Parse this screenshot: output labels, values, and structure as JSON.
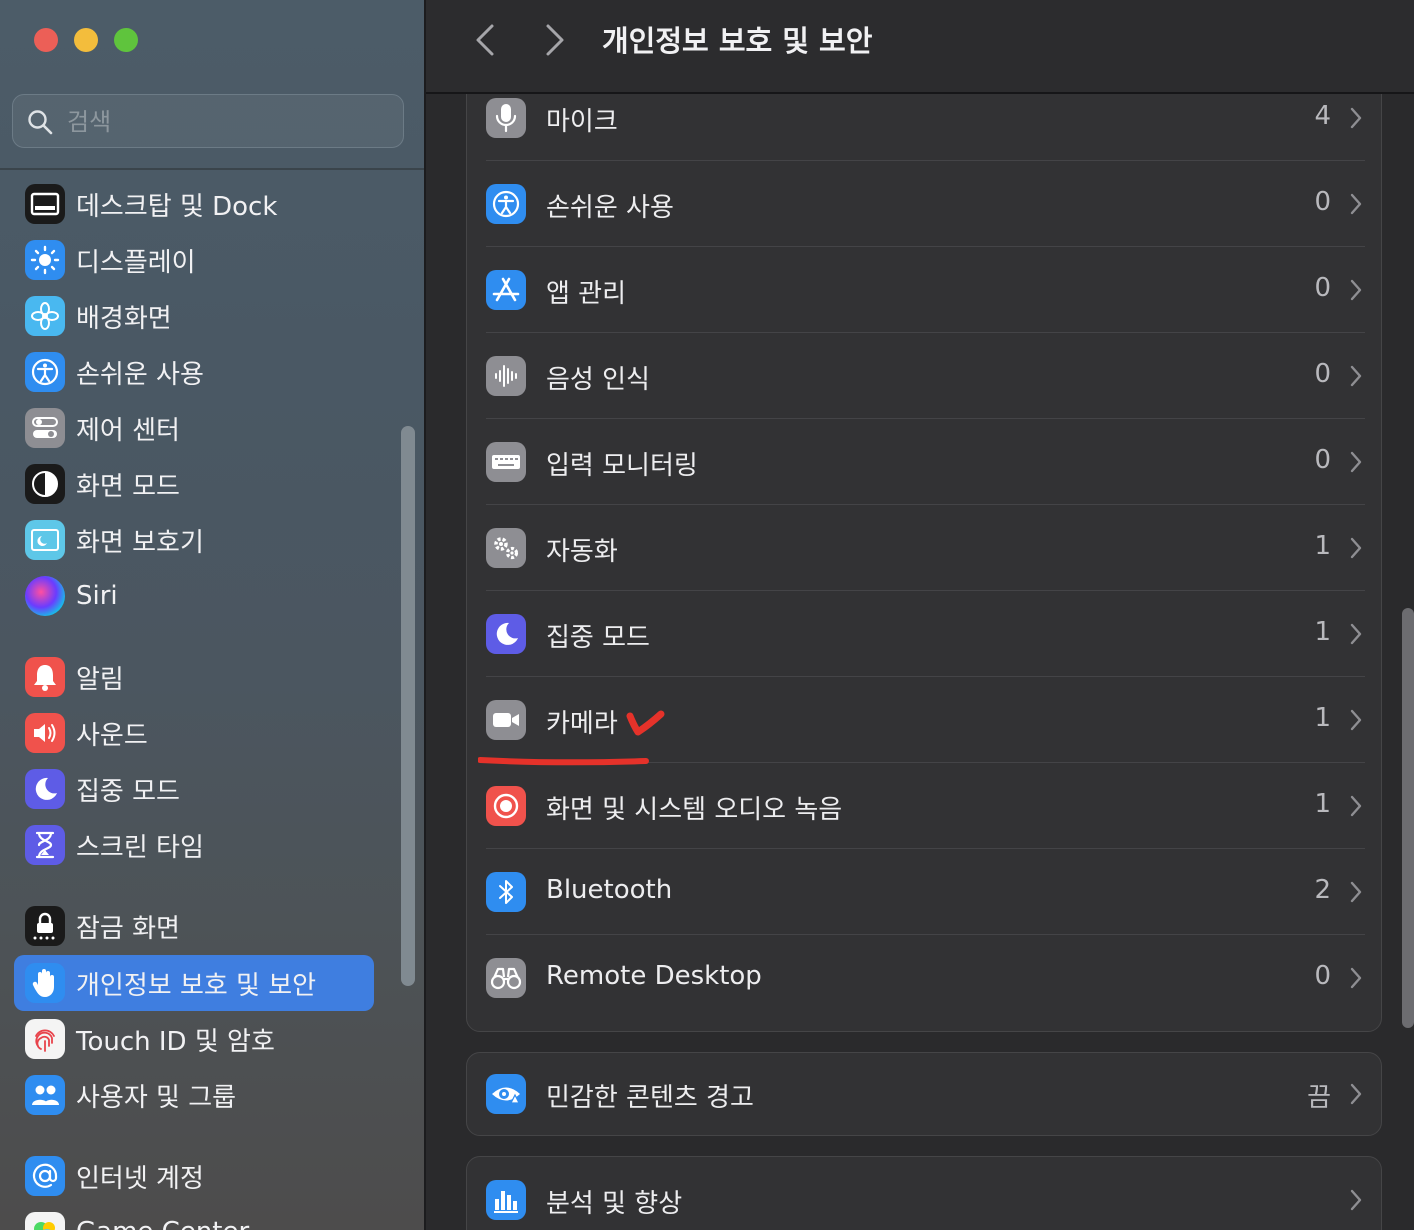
{
  "search": {
    "placeholder": "검색"
  },
  "sidebar": {
    "items": [
      {
        "label": "데스크탑 및 Dock"
      },
      {
        "label": "디스플레이"
      },
      {
        "label": "배경화면"
      },
      {
        "label": "손쉬운 사용"
      },
      {
        "label": "제어 센터"
      },
      {
        "label": "화면 모드"
      },
      {
        "label": "화면 보호기"
      },
      {
        "label": "Siri"
      },
      {
        "label": "알림"
      },
      {
        "label": "사운드"
      },
      {
        "label": "집중 모드"
      },
      {
        "label": "스크린 타임"
      },
      {
        "label": "잠금 화면"
      },
      {
        "label": "개인정보 보호 및 보안"
      },
      {
        "label": "Touch ID 및 암호"
      },
      {
        "label": "사용자 및 그룹"
      },
      {
        "label": "인터넷 계정"
      },
      {
        "label": "Game Center"
      }
    ],
    "active_label": "개인정보 보호 및 보안"
  },
  "header": {
    "title": "개인정보 보호 및 보안"
  },
  "rows": [
    {
      "label": "마이크",
      "value": "4"
    },
    {
      "label": "손쉬운 사용",
      "value": "0"
    },
    {
      "label": "앱 관리",
      "value": "0"
    },
    {
      "label": "음성 인식",
      "value": "0"
    },
    {
      "label": "입력 모니터링",
      "value": "0"
    },
    {
      "label": "자동화",
      "value": "1"
    },
    {
      "label": "집중 모드",
      "value": "1"
    },
    {
      "label": "카메라",
      "value": "1"
    },
    {
      "label": "화면 및 시스템 오디오 녹음",
      "value": "1"
    },
    {
      "label": "Bluetooth",
      "value": "2"
    },
    {
      "label": "Remote Desktop",
      "value": "0"
    }
  ],
  "sensitive": {
    "label": "민감한 콘텐츠 경고",
    "value": "끔"
  },
  "analytics": {
    "label": "분석 및 향상"
  },
  "colors": {
    "accent": "#3f7ee0",
    "annotation": "#e5322a"
  }
}
